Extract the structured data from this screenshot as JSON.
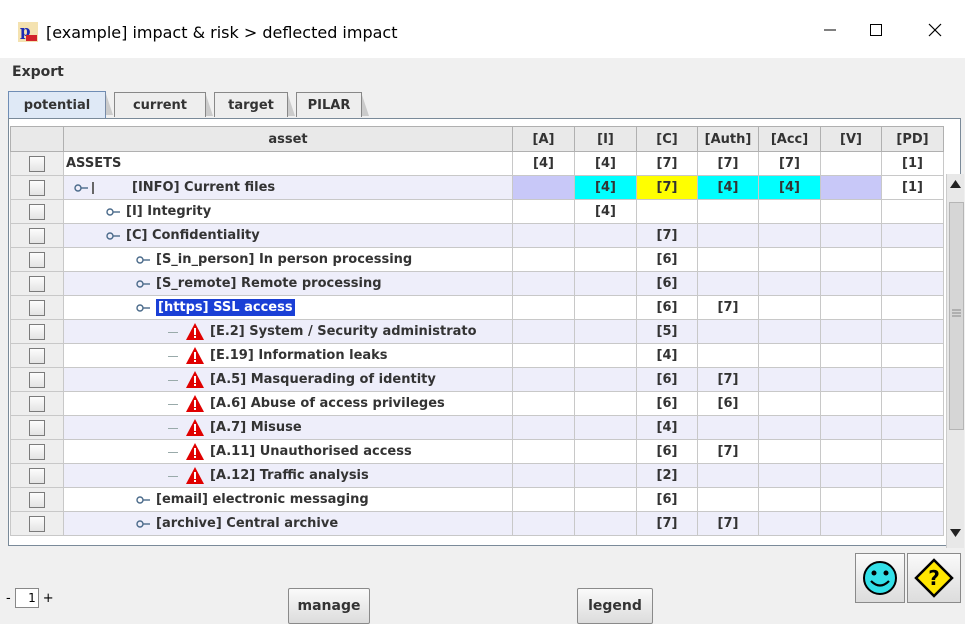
{
  "window": {
    "title": "[example] impact & risk > deflected impact"
  },
  "menu": {
    "export": "Export"
  },
  "tabs": [
    {
      "label": "potential",
      "active": true
    },
    {
      "label": "current"
    },
    {
      "label": "target"
    },
    {
      "label": "PILAR"
    }
  ],
  "columns": [
    "asset",
    "[A]",
    "[I]",
    "[C]",
    "[Auth]",
    "[Acc]",
    "[V]",
    "[PD]"
  ],
  "rows": [
    {
      "label": "ASSETS",
      "level": 0,
      "values": [
        "[4]",
        "[4]",
        "[7]",
        "[7]",
        "[7]",
        "",
        "[1]"
      ]
    },
    {
      "label": "[INFO] Current files",
      "level": 1,
      "values": [
        "",
        "[4]",
        "[7]",
        "[4]",
        "[4]",
        "",
        "[1]"
      ],
      "cell_colors": [
        "#c8c8f8",
        "#00ffff",
        "#ffff00",
        "#00ffff",
        "#00ffff",
        "#c8c8f8",
        "#ffffff"
      ]
    },
    {
      "label": "[I] Integrity",
      "level": 2,
      "values": [
        "",
        "[4]",
        "",
        "",
        "",
        "",
        ""
      ]
    },
    {
      "label": "[C] Confidentiality",
      "level": 2,
      "values": [
        "",
        "",
        "[7]",
        "",
        "",
        "",
        ""
      ]
    },
    {
      "label": "[S_in_person] In person processing",
      "level": 3,
      "values": [
        "",
        "",
        "[6]",
        "",
        "",
        "",
        ""
      ]
    },
    {
      "label": "[S_remote] Remote processing",
      "level": 3,
      "values": [
        "",
        "",
        "[6]",
        "",
        "",
        "",
        ""
      ]
    },
    {
      "label": "[https] SSL access",
      "level": 3,
      "selected": true,
      "values": [
        "",
        "",
        "[6]",
        "[7]",
        "",
        "",
        ""
      ]
    },
    {
      "label": "[E.2] System / Security administrato",
      "level": 4,
      "threat": true,
      "values": [
        "",
        "",
        "[5]",
        "",
        "",
        "",
        ""
      ]
    },
    {
      "label": "[E.19] Information leaks",
      "level": 4,
      "threat": true,
      "values": [
        "",
        "",
        "[4]",
        "",
        "",
        "",
        ""
      ]
    },
    {
      "label": "[A.5] Masquerading of identity",
      "level": 4,
      "threat": true,
      "values": [
        "",
        "",
        "[6]",
        "[7]",
        "",
        "",
        ""
      ]
    },
    {
      "label": "[A.6] Abuse of access privileges",
      "level": 4,
      "threat": true,
      "values": [
        "",
        "",
        "[6]",
        "[6]",
        "",
        "",
        ""
      ]
    },
    {
      "label": "[A.7] Misuse",
      "level": 4,
      "threat": true,
      "values": [
        "",
        "",
        "[4]",
        "",
        "",
        "",
        ""
      ]
    },
    {
      "label": "[A.11] Unauthorised access",
      "level": 4,
      "threat": true,
      "values": [
        "",
        "",
        "[6]",
        "[7]",
        "",
        "",
        ""
      ]
    },
    {
      "label": "[A.12] Traffic analysis",
      "level": 4,
      "threat": true,
      "values": [
        "",
        "",
        "[2]",
        "",
        "",
        "",
        ""
      ]
    },
    {
      "label": "[email] electronic messaging",
      "level": 3,
      "values": [
        "",
        "",
        "[6]",
        "",
        "",
        "",
        ""
      ]
    },
    {
      "label": "[archive] Central archive",
      "level": 3,
      "values": [
        "",
        "",
        "[7]",
        "[7]",
        "",
        "",
        ""
      ]
    }
  ],
  "pager": {
    "minus": "-",
    "page": "1",
    "plus": "+"
  },
  "buttons": {
    "manage": "manage",
    "legend": "legend"
  },
  "icons": {
    "smiley": "smiley-icon",
    "help": "help-icon",
    "threat": "warning-icon"
  }
}
